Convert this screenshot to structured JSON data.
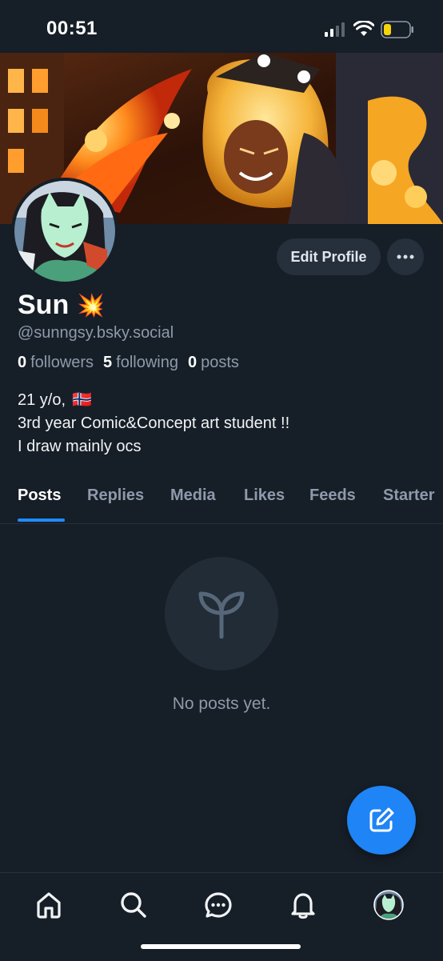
{
  "status_bar": {
    "time": "00:51"
  },
  "profile": {
    "display_name": "Sun",
    "name_emoji": "💥",
    "handle": "@sunngsy.bsky.social",
    "stats": {
      "followers_count": "0",
      "followers_label": "followers",
      "following_count": "5",
      "following_label": "following",
      "posts_count": "0",
      "posts_label": "posts"
    },
    "bio": {
      "line1": "21 y/o,",
      "line1_flag": "🇳🇴",
      "line2": "3rd year Comic&Concept art student !!",
      "line3": "I draw mainly ocs"
    }
  },
  "actions": {
    "edit_profile_label": "Edit Profile",
    "more_icon": "ellipsis-icon"
  },
  "tabs": [
    {
      "label": "Posts",
      "active": true
    },
    {
      "label": "Replies",
      "active": false
    },
    {
      "label": "Media",
      "active": false
    },
    {
      "label": "Likes",
      "active": false
    },
    {
      "label": "Feeds",
      "active": false
    },
    {
      "label": "Starter",
      "active": false
    }
  ],
  "empty_state": {
    "icon": "sprout-icon",
    "text": "No posts yet."
  },
  "fab": {
    "icon": "compose-icon"
  },
  "bottom_nav": {
    "items": [
      "home-icon",
      "search-icon",
      "chat-icon",
      "bell-icon",
      "profile-avatar"
    ]
  },
  "colors": {
    "background": "#161e27",
    "accent": "#208bfe",
    "muted_text": "#8e9aab",
    "button_bg": "#26303c"
  }
}
